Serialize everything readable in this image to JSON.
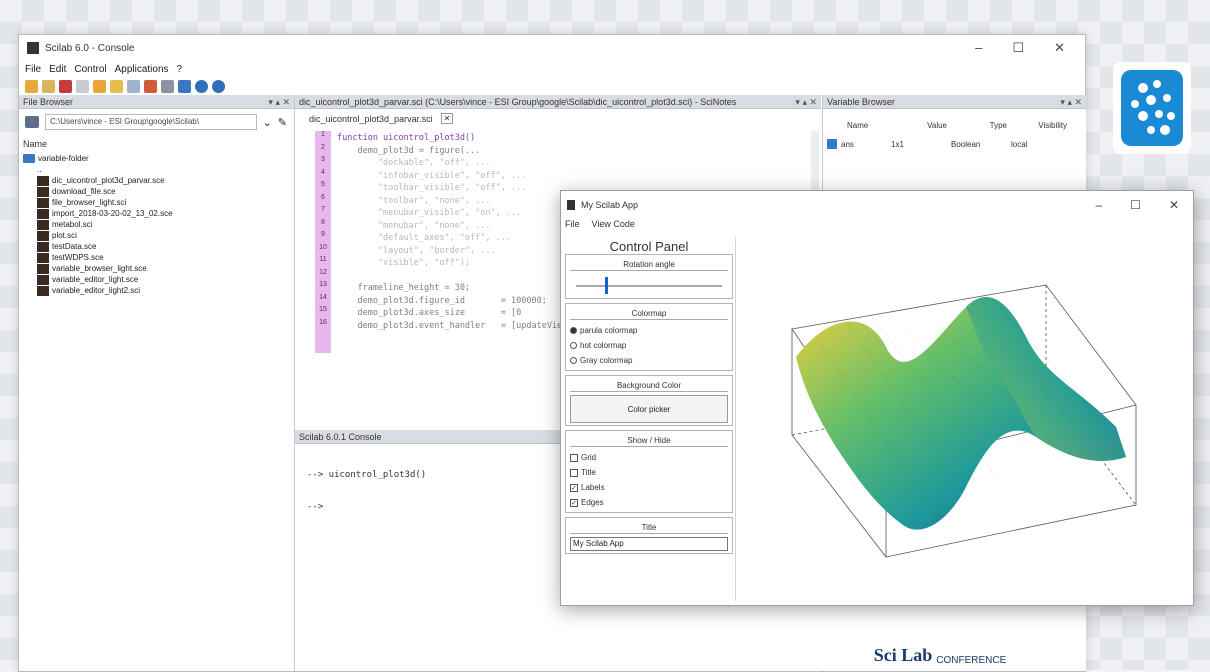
{
  "main_window": {
    "title": "Scilab 6.0 - Console",
    "menu": [
      "File",
      "Edit",
      "Control",
      "Applications",
      "?"
    ],
    "controls": [
      "–",
      "☐",
      "✕"
    ]
  },
  "file_browser": {
    "header": "File Browser",
    "path": "C:\\Users\\vince - ESI Group\\google\\Scilab\\",
    "column": "Name",
    "folder": "variable-folder",
    "items": [
      "..",
      "dic_uicontrol_plot3d_parvar.sce",
      "download_file.sce",
      "file_browser_light.sci",
      "import_2018-03-20-02_13_02.sce",
      "metabol.sci",
      "plot.sci",
      "testData.sce",
      "testWDPS.sce",
      "variable_browser_light.sce",
      "variable_editor_light.sce",
      "variable_editor_light2.sci"
    ]
  },
  "editor": {
    "header": "dic_uicontrol_plot3d_parvar.sci (C:\\Users\\vince - ESI Group\\google\\Scilab\\dic_uicontrol_plot3d.sci) - SciNotes",
    "tab": "dic_uicontrol_plot3d_parvar.sci",
    "lines": [
      "function uicontrol_plot3d()",
      "    demo_plot3d = figure(...",
      "        \"dockable\", \"off\", ...",
      "        \"infobar_visible\", \"off\", ...",
      "        \"toolbar_visible\", \"off\", ...",
      "        \"toolbar\", \"none\", ...",
      "        \"menubar_visible\", \"on\", ...",
      "        \"menubar\", \"none\", ...",
      "        \"default_axes\", \"off\", ...",
      "        \"layout\", \"border\", ...",
      "        \"visible\", \"off\");",
      "",
      "    frameline_height = 30;",
      "    demo_plot3d.figure_id       = 100000;",
      "    demo_plot3d.axes_size       = [0",
      "    demo_plot3d.event_handler   = [updateView]"
    ]
  },
  "console": {
    "header": "Scilab 6.0.1 Console",
    "prompt_line": "--> uicontrol_plot3d()",
    "prompt": "-->"
  },
  "variable_browser": {
    "header": "Variable Browser",
    "columns": [
      "Name",
      "Value",
      "Type",
      "Visibility"
    ],
    "row": [
      "ans",
      "",
      "1x1",
      "Boolean",
      "local"
    ]
  },
  "app_window": {
    "title": "My Scilab App",
    "menu": [
      "File",
      "View Code"
    ],
    "panel_title": "Control Panel",
    "rotation_label": "Rotation angle",
    "rotation_value": 0.2,
    "colormap_label": "Colormap",
    "colormaps": [
      {
        "label": "parula colormap",
        "selected": true
      },
      {
        "label": "hot colormap",
        "selected": false
      },
      {
        "label": "Gray colormap",
        "selected": false
      }
    ],
    "bg_label": "Background Color",
    "color_button": "Color picker",
    "show_hide_label": "Show / Hide",
    "checks": [
      {
        "label": "Grid",
        "checked": false
      },
      {
        "label": "Title",
        "checked": false
      },
      {
        "label": "Labels",
        "checked": true
      },
      {
        "label": "Edges",
        "checked": true
      }
    ],
    "title_label": "Title",
    "title_value": "My Scilab App"
  },
  "colors": {
    "accent": "#1463c8",
    "gutter": "#e9b6f0",
    "keyword": "#7a3fb0",
    "brand_blue": "#1a8ad4"
  },
  "branding": {
    "logo_text": "Sci Lab",
    "logo_sub": "CONFERENCE"
  }
}
